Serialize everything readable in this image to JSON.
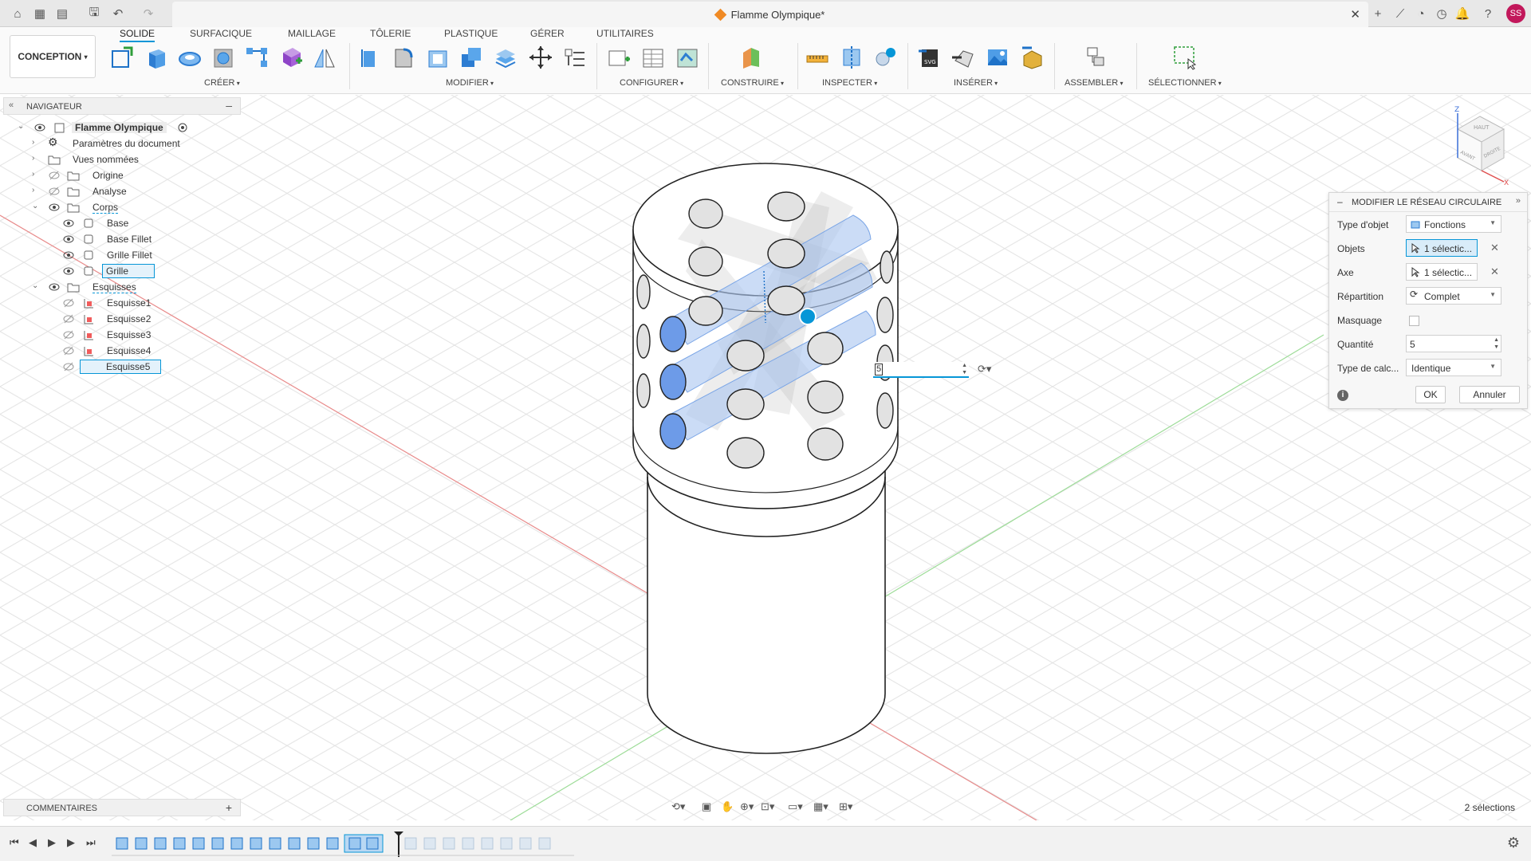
{
  "app": {
    "document_title": "Flamme Olympique*",
    "user_initials": "SS"
  },
  "toolbar": {
    "workspace": "CONCEPTION",
    "tabs": [
      "SOLIDE",
      "SURFACIQUE",
      "MAILLAGE",
      "TÔLERIE",
      "PLASTIQUE",
      "GÉRER",
      "UTILITAIRES"
    ],
    "active_tab": "SOLIDE",
    "groups": [
      "CRÉER",
      "MODIFIER",
      "CONFIGURER",
      "CONSTRUIRE",
      "INSPECTER",
      "INSÉRER",
      "ASSEMBLER",
      "SÉLECTIONNER"
    ]
  },
  "navigator": {
    "header": "NAVIGATEUR",
    "items": [
      {
        "label": "Flamme Olympique"
      },
      {
        "label": "Paramètres du document"
      },
      {
        "label": "Vues nommées"
      },
      {
        "label": "Origine"
      },
      {
        "label": "Analyse"
      },
      {
        "label": "Corps"
      },
      {
        "label": "Base"
      },
      {
        "label": "Base Fillet"
      },
      {
        "label": "Grille Fillet"
      },
      {
        "label": "Grille"
      },
      {
        "label": "Esquisses"
      },
      {
        "label": "Esquisse1"
      },
      {
        "label": "Esquisse2"
      },
      {
        "label": "Esquisse3"
      },
      {
        "label": "Esquisse4"
      },
      {
        "label": "Esquisse5"
      }
    ]
  },
  "comments": {
    "header": "COMMENTAIRES"
  },
  "dialog": {
    "title": "MODIFIER LE RÉSEAU CIRCULAIRE",
    "type_objet": {
      "label": "Type d'objet",
      "value": "Fonctions"
    },
    "objets": {
      "label": "Objets",
      "value": "1 sélectic..."
    },
    "axe": {
      "label": "Axe",
      "value": "1 sélectic..."
    },
    "repartition": {
      "label": "Répartition",
      "value": "Complet"
    },
    "masquage": {
      "label": "Masquage",
      "checked": false
    },
    "quantite": {
      "label": "Quantité",
      "value": "5"
    },
    "type_calcul": {
      "label": "Type de calc...",
      "value": "Identique"
    },
    "ok": "OK",
    "annuler": "Annuler"
  },
  "inline_input": {
    "value": "5"
  },
  "status": {
    "selections": "2 sélections"
  },
  "colors": {
    "accent": "#0696d7",
    "selected_hole": "#6d9be8",
    "pattern_body": "#a9c4f0"
  }
}
